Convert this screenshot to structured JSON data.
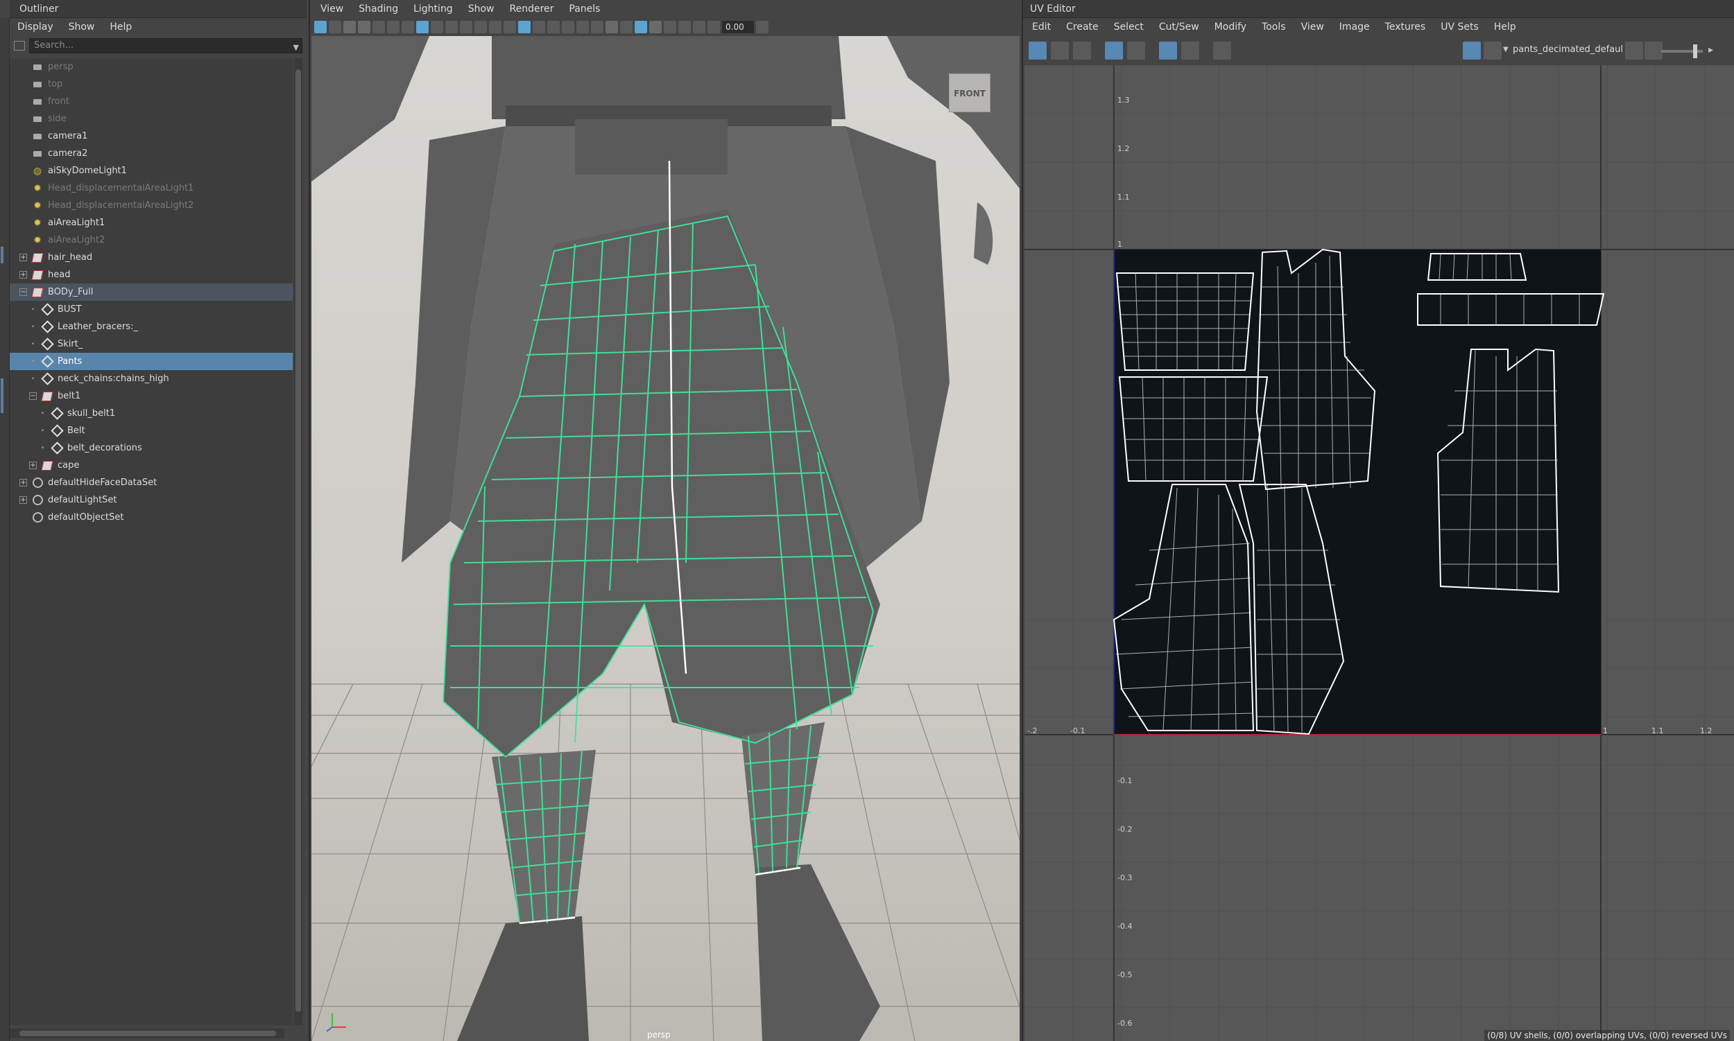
{
  "outliner": {
    "title": "Outliner",
    "menu": [
      "Display",
      "Show",
      "Help"
    ],
    "search_placeholder": "Search...",
    "items": [
      {
        "label": "persp",
        "icon": "camera-icon",
        "dim": true
      },
      {
        "label": "top",
        "icon": "camera-icon",
        "dim": true
      },
      {
        "label": "front",
        "icon": "camera-icon",
        "dim": true
      },
      {
        "label": "side",
        "icon": "camera-icon",
        "dim": true
      },
      {
        "label": "camera1",
        "icon": "camera-icon"
      },
      {
        "label": "camera2",
        "icon": "camera-icon"
      },
      {
        "label": "aiSkyDomeLight1",
        "icon": "skydome-icon"
      },
      {
        "label": "Head_displacementaiAreaLight1",
        "icon": "light-icon",
        "dim": true
      },
      {
        "label": "Head_displacementaiAreaLight2",
        "icon": "light-icon",
        "dim": true
      },
      {
        "label": "aiAreaLight1",
        "icon": "light-icon"
      },
      {
        "label": "aiAreaLight2",
        "icon": "light-icon",
        "dim": true
      },
      {
        "label": "hair_head",
        "icon": "group-icon",
        "expander": "+"
      },
      {
        "label": "head",
        "icon": "group-icon",
        "expander": "+"
      },
      {
        "label": "BODy_Full",
        "icon": "group-icon",
        "expander": "−",
        "highlight": true
      },
      {
        "label": "BUST",
        "icon": "mesh-icon",
        "indent": 1
      },
      {
        "label": "Leather_bracers:_",
        "icon": "mesh-icon",
        "indent": 1
      },
      {
        "label": "Skirt_",
        "icon": "mesh-icon",
        "indent": 1
      },
      {
        "label": "Pants",
        "icon": "mesh-icon",
        "indent": 1,
        "selected": true
      },
      {
        "label": "neck_chains:chains_high",
        "icon": "mesh-icon",
        "indent": 1
      },
      {
        "label": "belt1",
        "icon": "group-icon",
        "indent": 1,
        "expander": "−"
      },
      {
        "label": "skull_belt1",
        "icon": "mesh-icon",
        "indent": 2
      },
      {
        "label": "Belt",
        "icon": "mesh-icon",
        "indent": 2
      },
      {
        "label": "belt_decorations",
        "icon": "mesh-icon",
        "indent": 2
      },
      {
        "label": "cape",
        "icon": "group-icon",
        "indent": 1,
        "expander": "+"
      },
      {
        "label": "defaultHideFaceDataSet",
        "icon": "set-icon",
        "expander": "+"
      },
      {
        "label": "defaultLightSet",
        "icon": "set-icon",
        "expander": "+"
      },
      {
        "label": "defaultObjectSet",
        "icon": "set-icon"
      }
    ]
  },
  "viewport": {
    "menu": [
      "View",
      "Shading",
      "Lighting",
      "Show",
      "Renderer",
      "Panels"
    ],
    "exposure_value": "0.00",
    "view_cube_label": "FRONT",
    "camera_label": "persp"
  },
  "uv_editor": {
    "title": "UV Editor",
    "menu": [
      "Edit",
      "Create",
      "Select",
      "Cut/Sew",
      "Modify",
      "Tools",
      "View",
      "Image",
      "Textures",
      "UV Sets",
      "Help"
    ],
    "texture_name": "pants_decimated_defaul",
    "axis_top": [
      "1.3",
      "1.2",
      "1.1",
      "1"
    ],
    "axis_bottom": [
      "-0.1",
      "-0.2",
      "-0.3",
      "-0.4",
      "-0.5",
      "-0.6"
    ],
    "axis_x": [
      "-.2",
      "-0.1",
      "1",
      "1.1",
      "1.2"
    ],
    "status": "(0/8) UV shells, (0/0) overlapping UVs, (0/0) reversed UVs"
  },
  "colors": {
    "selection": "#5985ad",
    "wire": "#3ee59a",
    "uv_wire": "#ffffff",
    "uv_tile": "#0f1419"
  }
}
